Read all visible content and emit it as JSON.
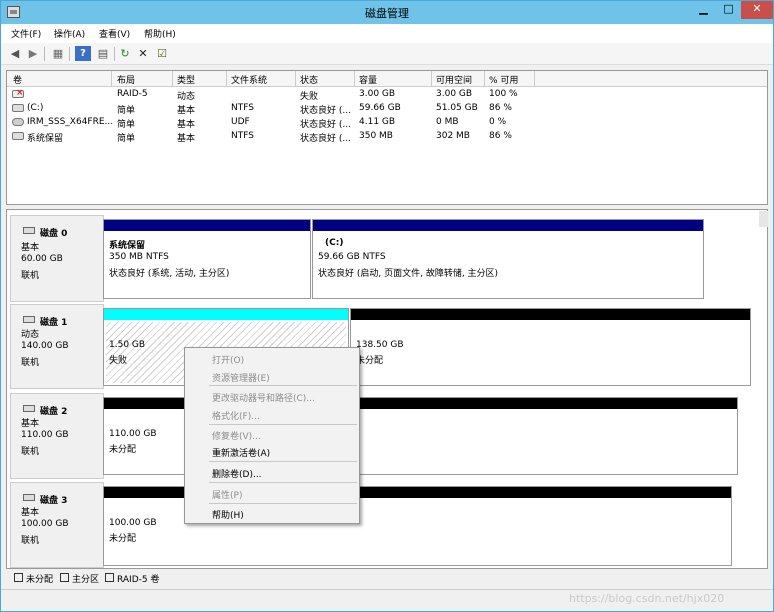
{
  "window": {
    "title": "磁盘管理",
    "min_glyph": "▁",
    "max_glyph": "□",
    "close_glyph": "✕"
  },
  "menu": [
    "文件(F)",
    "操作(A)",
    "查看(V)",
    "帮助(H)"
  ],
  "toolbar": {
    "back": "◀",
    "forward": "▶",
    "properties": "▦",
    "help": "?",
    "view": "▤",
    "refresh": "↻",
    "delete": "✕",
    "check": "☑"
  },
  "volumes": {
    "headers": [
      "卷",
      "布局",
      "类型",
      "文件系统",
      "状态",
      "容量",
      "可用空间",
      "% 可用"
    ],
    "rows": [
      {
        "name": "",
        "layout": "RAID-5",
        "type": "动态",
        "fs": "",
        "status": "失败",
        "capacity": "3.00 GB",
        "free": "3.00 GB",
        "pct": "100 %"
      },
      {
        "name": "(C:)",
        "layout": "简单",
        "type": "基本",
        "fs": "NTFS",
        "status": "状态良好 (...",
        "capacity": "59.66 GB",
        "free": "51.05 GB",
        "pct": "86 %"
      },
      {
        "name": "IRM_SSS_X64FRE...",
        "layout": "简单",
        "type": "基本",
        "fs": "UDF",
        "status": "状态良好 (...",
        "capacity": "4.11 GB",
        "free": "0 MB",
        "pct": "0 %"
      },
      {
        "name": "系统保留",
        "layout": "简单",
        "type": "基本",
        "fs": "NTFS",
        "status": "状态良好 (...",
        "capacity": "350 MB",
        "free": "302 MB",
        "pct": "86 %"
      }
    ]
  },
  "disks": [
    {
      "name": "磁盘 0",
      "type": "基本",
      "size": "60.00 GB",
      "state": "联机",
      "partitions": [
        {
          "title": "系统保留",
          "size": "350 MB NTFS",
          "status": "状态良好 (系统, 活动, 主分区)"
        },
        {
          "title": "(C:)",
          "size": "59.66 GB NTFS",
          "status": "状态良好 (启动, 页面文件, 故障转储, 主分区)"
        }
      ]
    },
    {
      "name": "磁盘 1",
      "type": "动态",
      "size": "140.00 GB",
      "state": "联机",
      "partitions": [
        {
          "size": "1.50 GB",
          "status": "失败"
        },
        {
          "size": "138.50 GB",
          "status": "未分配"
        }
      ]
    },
    {
      "name": "磁盘 2",
      "type": "基本",
      "size": "110.00 GB",
      "state": "联机",
      "partitions": [
        {
          "size": "110.00 GB",
          "status": "未分配"
        }
      ]
    },
    {
      "name": "磁盘 3",
      "type": "基本",
      "size": "100.00 GB",
      "state": "联机",
      "partitions": [
        {
          "size": "100.00 GB",
          "status": "未分配"
        }
      ]
    }
  ],
  "legend": [
    {
      "label": "未分配",
      "color": "#000000"
    },
    {
      "label": "主分区",
      "color": "#000080"
    },
    {
      "label": "RAID-5 卷",
      "color": "#00ffff"
    }
  ],
  "context_menu": {
    "items": [
      {
        "label": "打开(O)",
        "enabled": false
      },
      {
        "label": "资源管理器(E)",
        "enabled": false
      },
      {
        "label": "更改驱动器号和路径(C)...",
        "enabled": false
      },
      {
        "label": "格式化(F)...",
        "enabled": false
      },
      {
        "label": "修复卷(V)...",
        "enabled": false
      },
      {
        "label": "重新激活卷(A)",
        "enabled": true
      },
      {
        "label": "删除卷(D)...",
        "enabled": true
      },
      {
        "label": "属性(P)",
        "enabled": false
      },
      {
        "label": "帮助(H)",
        "enabled": true
      }
    ]
  },
  "watermark": "https://blog.csdn.net/hjx020"
}
